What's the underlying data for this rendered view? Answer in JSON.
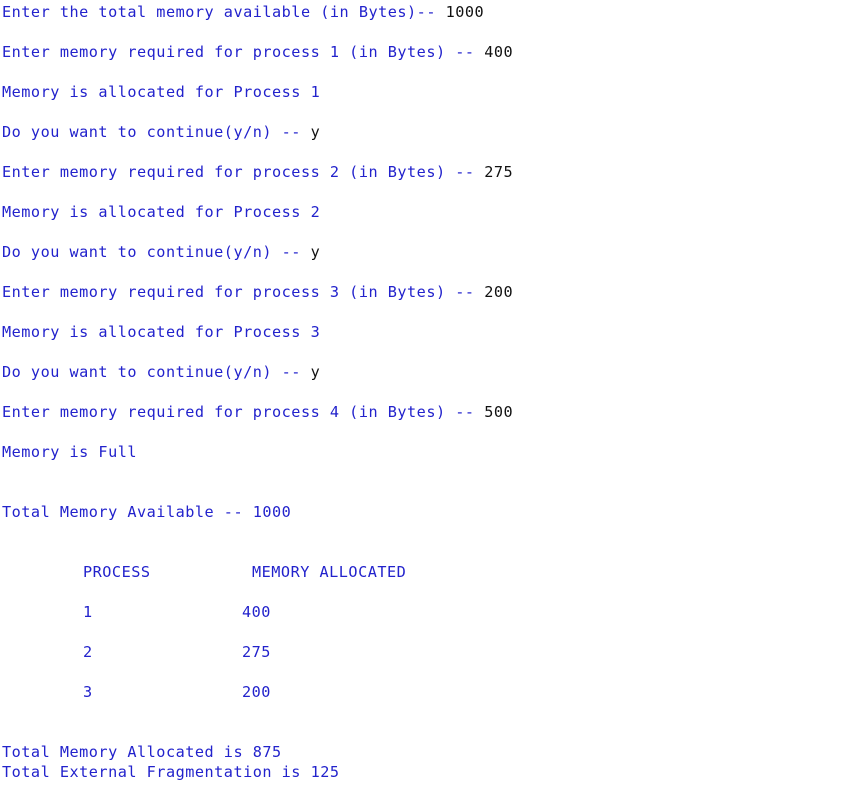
{
  "console": {
    "prompt_total": "Enter the total memory available (in Bytes)-- ",
    "input_total": "1000",
    "p1_prompt": "Enter memory required for process 1 (in Bytes) -- ",
    "p1_input": "400",
    "p1_msg": "Memory is allocated for Process 1",
    "c1_prompt": "Do you want to continue(y/n) -- ",
    "c1_input": "y",
    "p2_prompt": "Enter memory required for process 2 (in Bytes) -- ",
    "p2_input": "275",
    "p2_msg": "Memory is allocated for Process 2",
    "c2_prompt": "Do you want to continue(y/n) -- ",
    "c2_input": "y",
    "p3_prompt": "Enter memory required for process 3 (in Bytes) -- ",
    "p3_input": "200",
    "p3_msg": "Memory is allocated for Process 3",
    "c3_prompt": "Do you want to continue(y/n) -- ",
    "c3_input": "y",
    "p4_prompt": "Enter memory required for process 4 (in Bytes) -- ",
    "p4_input": "500",
    "full_msg": "Memory is Full",
    "total_available": "Total Memory Available -- 1000",
    "table": {
      "header_process": "PROCESS",
      "header_memory": "MEMORY ALLOCATED",
      "rows": [
        {
          "process": "1",
          "memory": "400"
        },
        {
          "process": "2",
          "memory": "275"
        },
        {
          "process": "3",
          "memory": "200"
        }
      ]
    },
    "total_allocated": "Total Memory Allocated is 875",
    "total_fragmentation": "Total External Fragmentation is 125"
  }
}
